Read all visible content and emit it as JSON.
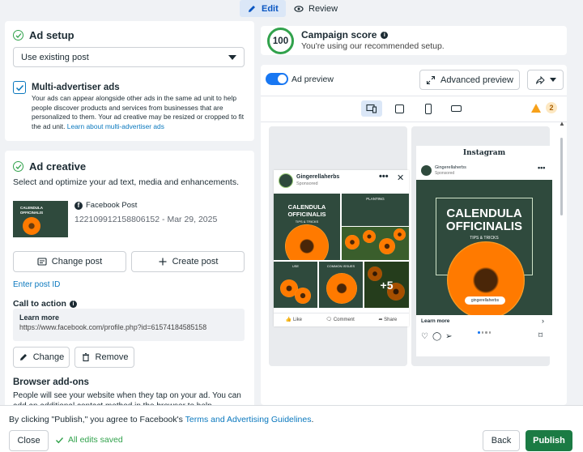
{
  "tabs": {
    "edit": "Edit",
    "review": "Review"
  },
  "ad_setup": {
    "title": "Ad setup",
    "select_value": "Use existing post",
    "multi_title": "Multi-advertiser ads",
    "multi_desc": "Your ads can appear alongside other ads in the same ad unit to help people discover products and services from businesses that are personalized to them. Your ad creative may be resized or cropped to fit the ad unit.",
    "multi_link": "Learn about multi-advertiser ads",
    "multi_checked": true
  },
  "ad_creative": {
    "title": "Ad creative",
    "subtext": "Select and optimize your ad text, media and enhancements.",
    "post_source": "Facebook Post",
    "post_id": "122109912158806152 - Mar 29, 2025",
    "change_post": "Change post",
    "create_post": "Create post",
    "enter_post_id": "Enter post ID",
    "cta_title": "Call to action",
    "cta_line1": "Learn more",
    "cta_line2": "https://www.facebook.com/profile.php?id=61574184585158",
    "change": "Change",
    "remove": "Remove",
    "addons_title": "Browser add-ons",
    "addons_desc": "People will see your website when they tap on your ad. You can add an additional contact method in the browser to help"
  },
  "score": {
    "value": "100",
    "title": "Campaign score",
    "subtitle": "You're using our recommended setup."
  },
  "preview": {
    "toggle_label": "Ad preview",
    "advanced_label": "Advanced preview",
    "warning_count": "2",
    "fb": {
      "page_name": "Gingerellaherbs",
      "sponsored": "Sponsored",
      "tile_title": "CALENDULA OFFICINALIS",
      "tile_sub": "TIPS & TRICKS",
      "planting": "PLANTING",
      "use": "USE",
      "common_issues": "COMMON ISSUES",
      "more_count": "+5",
      "like": "Like",
      "comment": "Comment",
      "share": "Share"
    },
    "ig": {
      "logo": "Instagram",
      "page_name": "Gingerellaherbs",
      "sponsored": "Sponsored",
      "title_l1": "CALENDULA",
      "title_l2": "OFFICINALIS",
      "sub": "TIPS & TRICKS",
      "handle": "gingerellaherbs",
      "learn_more": "Learn more"
    }
  },
  "bottom": {
    "agree_prefix": "By clicking \"Publish,\" you agree to Facebook's ",
    "agree_link": "Terms and Advertising Guidelines",
    "agree_suffix": ".",
    "close": "Close",
    "saved": "All edits saved",
    "back": "Back",
    "publish": "Publish"
  },
  "colors": {
    "accent": "#1877f2",
    "publish": "#1b7b44",
    "success": "#31a24c",
    "link": "#0a78be"
  }
}
